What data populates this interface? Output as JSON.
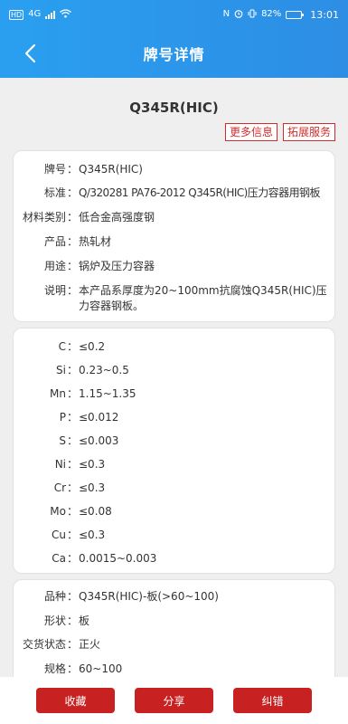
{
  "status_bar": {
    "left_badge": "HD",
    "network": "4G",
    "nfc": "N",
    "battery_text": "82%",
    "battery_level": 0.82,
    "time": "13:01"
  },
  "nav": {
    "title": "牌号详情"
  },
  "grade": {
    "title": "Q345R(HIC)",
    "more_info": "更多信息",
    "extended_service": "拓展服务"
  },
  "info": [
    {
      "label": "牌号",
      "value": "Q345R(HIC)"
    },
    {
      "label": "标准",
      "value": "Q/320281 PA76-2012 Q345R(HIC)压力容器用钢板"
    },
    {
      "label": "材料类别",
      "value": "低合金高强度钢"
    },
    {
      "label": "产品",
      "value": "热轧材"
    },
    {
      "label": "用途",
      "value": "锅炉及压力容器"
    },
    {
      "label": "说明",
      "value": "本产品系厚度为20~100mm抗腐蚀Q345R(HIC)压力容器钢板。"
    }
  ],
  "chemistry": [
    {
      "label": "C",
      "value": "≤0.2"
    },
    {
      "label": "Si",
      "value": "0.23~0.5"
    },
    {
      "label": "Mn",
      "value": "1.15~1.35"
    },
    {
      "label": "P",
      "value": "≤0.012"
    },
    {
      "label": "S",
      "value": "≤0.003"
    },
    {
      "label": "Ni",
      "value": "≤0.3"
    },
    {
      "label": "Cr",
      "value": "≤0.3"
    },
    {
      "label": "Mo",
      "value": "≤0.08"
    },
    {
      "label": "Cu",
      "value": "≤0.3"
    },
    {
      "label": "Ca",
      "value": "0.0015~0.003"
    }
  ],
  "product": [
    {
      "label": "品种",
      "value": "Q345R(HIC)-板(>60~100)"
    },
    {
      "label": "形状",
      "value": "板"
    },
    {
      "label": "交货状态",
      "value": "正火"
    },
    {
      "label": "规格",
      "value": "60~100"
    }
  ],
  "separator": "：",
  "bottom": {
    "favorite": "收藏",
    "share": "分享",
    "correct": "纠错"
  }
}
